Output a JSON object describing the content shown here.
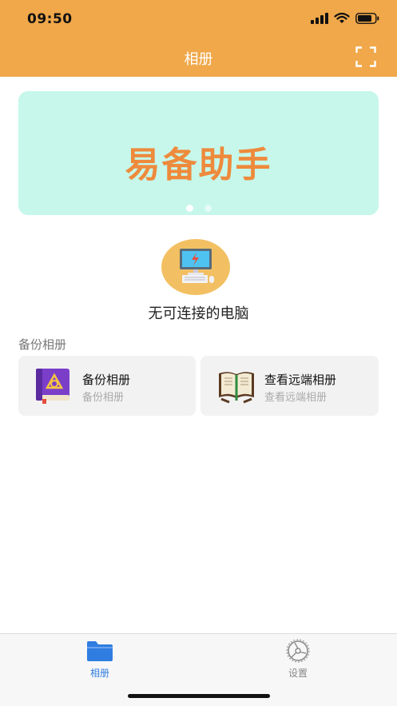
{
  "status_bar": {
    "time": "09:50"
  },
  "header": {
    "title": "相册",
    "scan_icon": "scan-frame-icon"
  },
  "banner": {
    "text": "易备助手",
    "page_count": 2,
    "active_page": 1,
    "bg_color": "#c6f7ea",
    "text_color": "#ee8a3c"
  },
  "computer": {
    "icon": "computer-icon",
    "status_text": "无可连接的电脑"
  },
  "section": {
    "label": "备份相册"
  },
  "cards": [
    {
      "title": "备份相册",
      "subtitle": "备份相册",
      "icon": "purple-book-icon"
    },
    {
      "title": "查看远端相册",
      "subtitle": "查看远端相册",
      "icon": "open-book-icon"
    }
  ],
  "tabbar": {
    "tabs": [
      {
        "label": "相册",
        "icon": "folder-icon",
        "active": true
      },
      {
        "label": "设置",
        "icon": "settings-icon",
        "active": false
      }
    ]
  },
  "colors": {
    "accent": "#f0a84a",
    "tab_active": "#2f7de1"
  }
}
